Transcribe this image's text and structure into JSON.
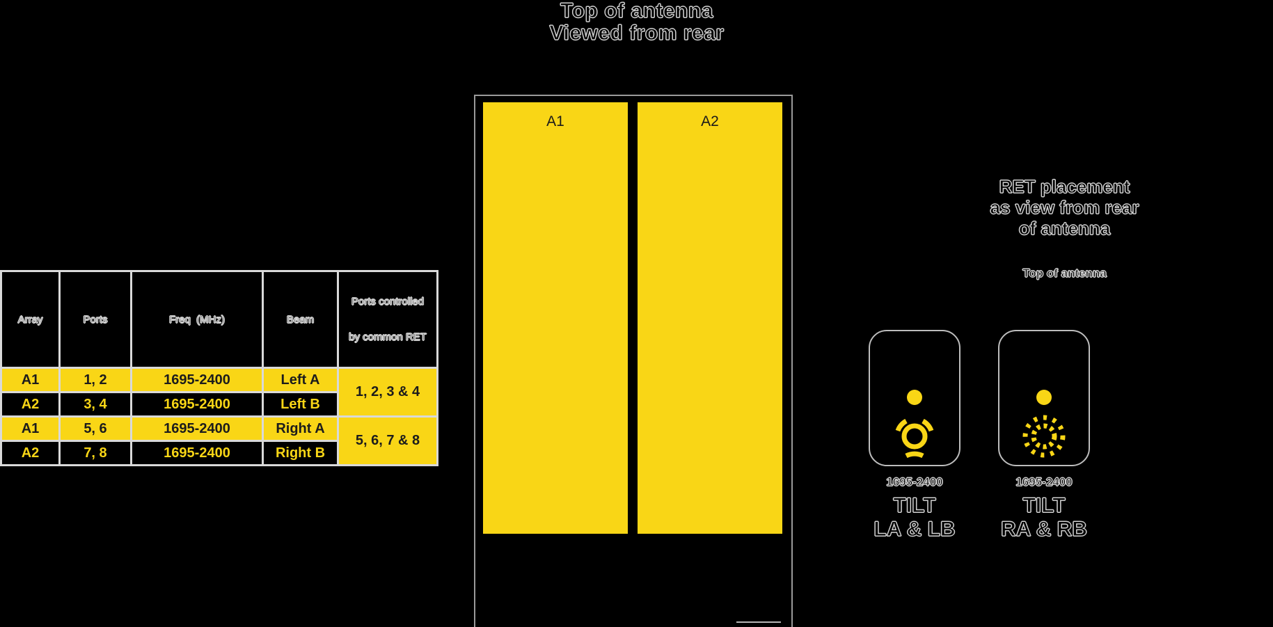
{
  "top_heading": {
    "line1": "Top of antenna",
    "line2": "Viewed from rear"
  },
  "antenna_view": {
    "arrays": [
      {
        "label": "A1"
      },
      {
        "label": "A2"
      }
    ]
  },
  "spec_table": {
    "headers": {
      "array": "Array",
      "ports": "Ports",
      "freq": "Freq  (MHz)",
      "beam": "Beam",
      "common_line1": "Ports controlled",
      "common_line2": "by common RET"
    },
    "rows": [
      {
        "array": "A1",
        "ports": "1, 2",
        "freq": "1695-2400",
        "beam": "Left A"
      },
      {
        "array": "A2",
        "ports": "3, 4",
        "freq": "1695-2400",
        "beam": "Left B"
      },
      {
        "array": "A1",
        "ports": "5, 6",
        "freq": "1695-2400",
        "beam": "Right A"
      },
      {
        "array": "A2",
        "ports": "7, 8",
        "freq": "1695-2400",
        "beam": "Right B"
      }
    ],
    "common_groups": [
      "1, 2, 3 & 4",
      "5, 6, 7 & 8"
    ]
  },
  "ret_section": {
    "heading_line1": "RET placement",
    "heading_line2": "as view from rear",
    "heading_line3": "of antenna",
    "subheading": "Top of antenna",
    "modules": [
      {
        "icon": "ret-solid-ring-icon",
        "freq": "1695-2400",
        "tilt": "TILT",
        "pair": "LA & LB"
      },
      {
        "icon": "ret-dotted-ring-icon",
        "freq": "1695-2400",
        "tilt": "TILT",
        "pair": "RA & RB"
      }
    ]
  },
  "colors": {
    "accent_yellow": "#f9d616",
    "background": "#000000",
    "outline": "#cfcfcf"
  }
}
